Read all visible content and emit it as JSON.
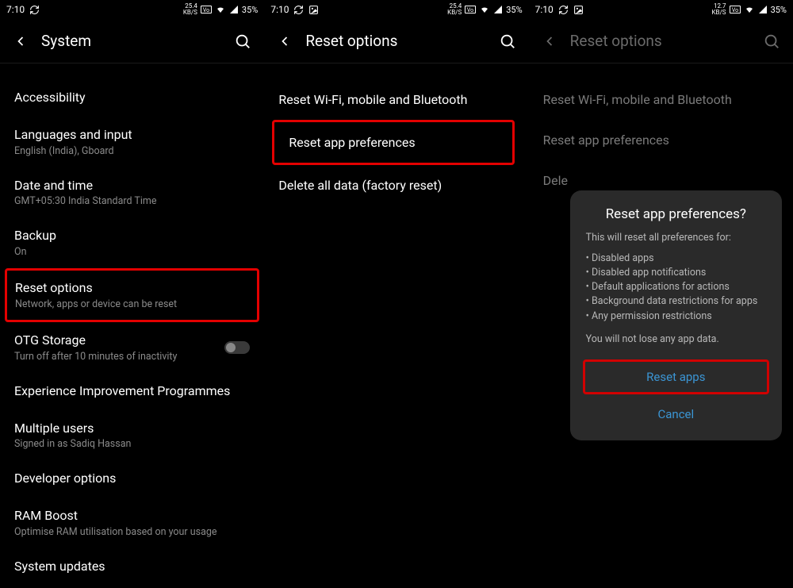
{
  "status": {
    "time": "7:10",
    "kbps": "25.4",
    "kbps_unit": "KB/S",
    "kbps3": "12.7",
    "battery": "35%"
  },
  "panel1": {
    "title": "System",
    "items": {
      "accessibility": "Accessibility",
      "lang_title": "Languages and input",
      "lang_sub": "English (India), Gboard",
      "date_title": "Date and time",
      "date_sub": "GMT+05:30 India Standard Time",
      "backup_title": "Backup",
      "backup_sub": "On",
      "reset_title": "Reset options",
      "reset_sub": "Network, apps or device can be reset",
      "otg_title": "OTG Storage",
      "otg_sub": "Turn off after 10 minutes of inactivity",
      "exp_title": "Experience Improvement Programmes",
      "multi_title": "Multiple users",
      "multi_sub": "Signed in as Sadiq Hassan",
      "dev_title": "Developer options",
      "ram_title": "RAM Boost",
      "ram_sub": "Optimise RAM utilisation based on your usage",
      "sys_title": "System updates"
    }
  },
  "panel2": {
    "title": "Reset options",
    "items": {
      "wifi": "Reset Wi-Fi, mobile and Bluetooth",
      "appprefs": "Reset app preferences",
      "factory": "Delete all data (factory reset)"
    }
  },
  "panel3": {
    "title": "Reset options",
    "items": {
      "wifi": "Reset Wi-Fi, mobile and Bluetooth",
      "appprefs": "Reset app preferences",
      "factory": "Delete all data (factory reset)"
    },
    "dialog": {
      "heading": "Reset app preferences?",
      "lead": "This will reset all preferences for:",
      "bullets": [
        "Disabled apps",
        "Disabled app notifications",
        "Default applications for actions",
        "Background data restrictions for apps",
        "Any permission restrictions"
      ],
      "note": "You will not lose any app data.",
      "primary": "Reset apps",
      "cancel": "Cancel"
    }
  }
}
